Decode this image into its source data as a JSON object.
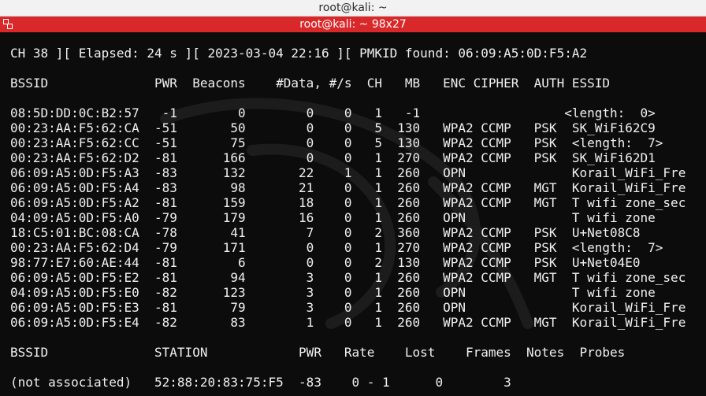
{
  "window": {
    "title": "root@kali: ~",
    "terminal_title": "root@kali: ~ 98x27"
  },
  "terminal": {
    "status_line": "CH 38 ][ Elapsed: 24 s ][ 2023-03-04 22:16 ][ PMKID found: 06:09:A5:0D:F5:A2",
    "ap_header": "BSSID              PWR  Beacons    #Data, #/s  CH   MB   ENC CIPHER  AUTH ESSID",
    "ap_rows": [
      "08:5D:DD:0C:B2:57   -1        0        0    0   1   -1                   <length:  0>",
      "00:23:AA:F5:62:CA  -51       50        0    0   5  130   WPA2 CCMP   PSK  SK_WiFi62C9",
      "00:23:AA:F5:62:CC  -51       75        0    0   5  130   WPA2 CCMP   PSK  <length:  7>",
      "00:23:AA:F5:62:D2  -81      166        0    0   1  270   WPA2 CCMP   PSK  SK_WiFi62D1",
      "06:09:A5:0D:F5:A3  -83      132       22    1   1  260   OPN              Korail_WiFi_Fre",
      "06:09:A5:0D:F5:A4  -83       98       21    0   1  260   WPA2 CCMP   MGT  Korail_WiFi_Fre",
      "06:09:A5:0D:F5:A2  -81      159       18    0   1  260   WPA2 CCMP   MGT  T wifi zone_sec",
      "04:09:A5:0D:F5:A0  -79      179       16    0   1  260   OPN              T wifi zone",
      "18:C5:01:BC:08:CA  -78       41        7    0   2  360   WPA2 CCMP   PSK  U+Net08C8",
      "00:23:AA:F5:62:D4  -79      171        0    0   1  270   WPA2 CCMP   PSK  <length:  7>",
      "98:77:E7:60:AE:44  -81        6        0    0   2  130   WPA2 CCMP   PSK  U+Net04E0",
      "06:09:A5:0D:F5:E2  -81       94        3    0   1  260   WPA2 CCMP   MGT  T wifi zone_sec",
      "04:09:A5:0D:F5:E0  -82      123        3    0   1  260   OPN              T wifi zone",
      "06:09:A5:0D:F5:E3  -81       79        3    0   1  260   OPN              Korail_WiFi_Fre",
      "06:09:A5:0D:F5:E4  -82       83        1    0   1  260   WPA2 CCMP   MGT  Korail_WiFi_Fre"
    ],
    "station_header": "BSSID              STATION            PWR   Rate    Lost    Frames  Notes  Probes",
    "station_rows": [
      "(not associated)   52:88:20:83:75:F5  -83    0 - 1      0        3"
    ]
  },
  "icons": {
    "window_icon": "terminal-window-icon",
    "background": "kali-dragon-watermark"
  },
  "colors": {
    "title_bar": "#d8282a",
    "terminal_bg": "#0c0c0c",
    "text": "#f0f0f0"
  }
}
